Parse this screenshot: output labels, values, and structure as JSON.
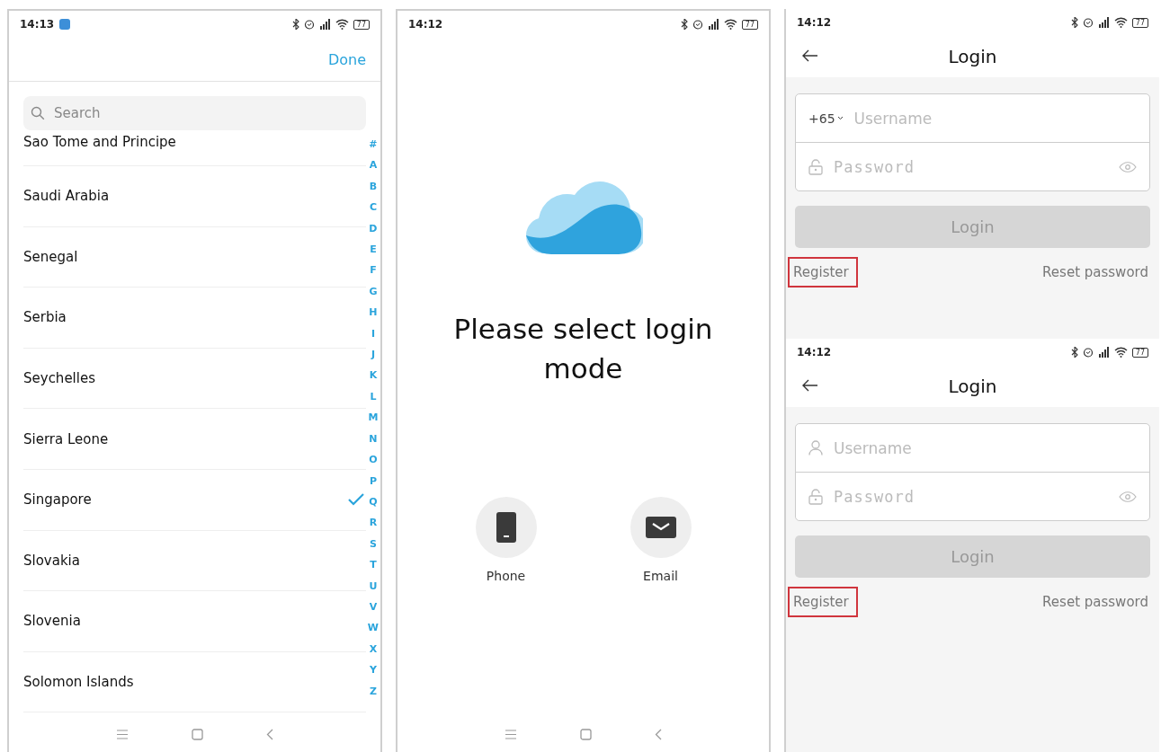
{
  "columns": [
    {
      "screens": [
        {
          "kind": "country_picker",
          "status_bar": {
            "time": "14:13",
            "app_notification": true,
            "battery": "77"
          },
          "done": "Done",
          "search": {
            "placeholder": "Search"
          },
          "countries": [
            {
              "name": "Sao Tome and Principe",
              "selected": false
            },
            {
              "name": "Saudi Arabia",
              "selected": false
            },
            {
              "name": "Senegal",
              "selected": false
            },
            {
              "name": "Serbia",
              "selected": false
            },
            {
              "name": "Seychelles",
              "selected": false
            },
            {
              "name": "Sierra Leone",
              "selected": false
            },
            {
              "name": "Singapore",
              "selected": true
            },
            {
              "name": "Slovakia",
              "selected": false
            },
            {
              "name": "Slovenia",
              "selected": false
            },
            {
              "name": "Solomon Islands",
              "selected": false
            }
          ],
          "index": [
            "#",
            "A",
            "B",
            "C",
            "D",
            "E",
            "F",
            "G",
            "H",
            "I",
            "J",
            "K",
            "L",
            "M",
            "N",
            "O",
            "P",
            "Q",
            "R",
            "S",
            "T",
            "U",
            "V",
            "W",
            "X",
            "Y",
            "Z"
          ],
          "nav_bar": true
        }
      ]
    },
    {
      "screens": [
        {
          "kind": "login_mode",
          "status_bar": {
            "time": "14:12",
            "app_notification": false,
            "battery": "77"
          },
          "title": "Please select login mode",
          "options": [
            {
              "kind": "phone",
              "label": "Phone"
            },
            {
              "kind": "email",
              "label": "Email"
            }
          ],
          "nav_bar": true
        }
      ]
    },
    {
      "screens": [
        {
          "kind": "login",
          "status_bar": {
            "time": "14:12",
            "app_notification": false,
            "battery": "77"
          },
          "title": "Login",
          "username": {
            "prefix": "+65",
            "placeholder": "Username"
          },
          "password": {
            "placeholder": "Password"
          },
          "login_button": {
            "label": "Login",
            "disabled": true
          },
          "register": {
            "label": "Register",
            "highlighted": true
          },
          "reset": "Reset password"
        },
        {
          "kind": "login",
          "status_bar": {
            "time": "14:12",
            "app_notification": false,
            "battery": "77"
          },
          "title": "Login",
          "username": {
            "placeholder": "Username"
          },
          "password": {
            "placeholder": "Password"
          },
          "login_button": {
            "label": "Login",
            "disabled": true
          },
          "register": {
            "label": "Register",
            "highlighted": true
          },
          "reset": "Reset password"
        }
      ]
    }
  ]
}
